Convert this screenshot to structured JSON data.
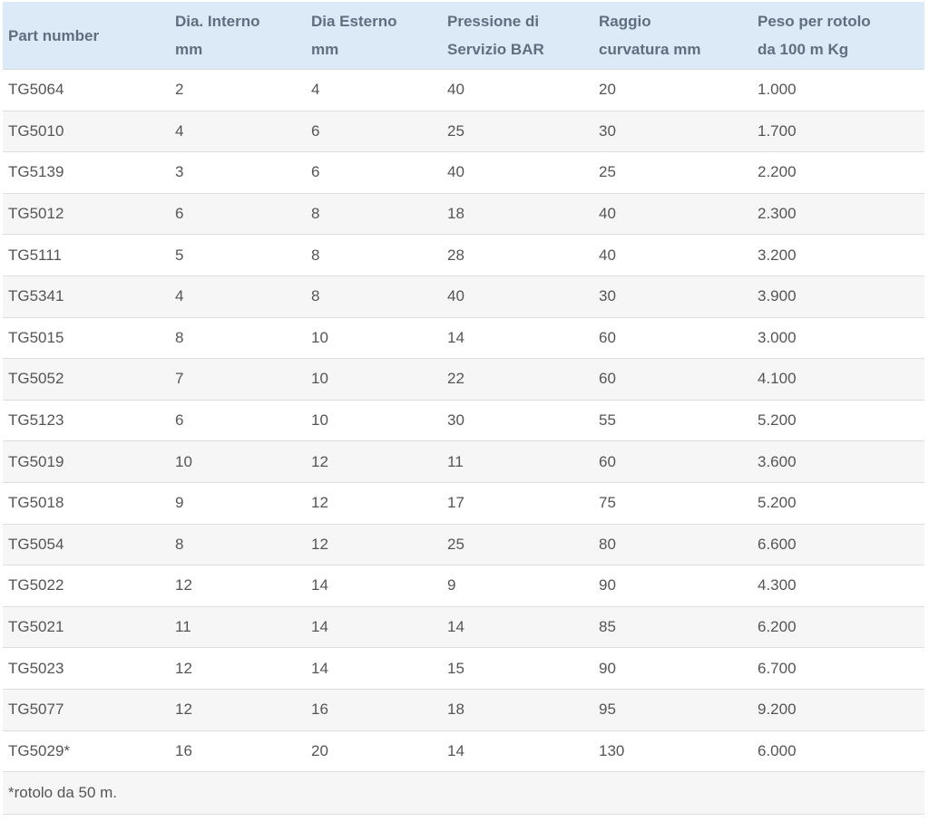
{
  "table": {
    "headers": [
      "Part number",
      "Dia. Interno\nmm",
      "Dia Esterno\nmm",
      "Pressione di\nServizio BAR",
      "Raggio\ncurvatura mm",
      "Peso per rotolo\nda 100 m Kg"
    ],
    "rows": [
      [
        "TG5064",
        "2",
        "4",
        "40",
        "20",
        "1.000"
      ],
      [
        "TG5010",
        "4",
        "6",
        "25",
        "30",
        "1.700"
      ],
      [
        "TG5139",
        "3",
        "6",
        "40",
        "25",
        "2.200"
      ],
      [
        "TG5012",
        "6",
        "8",
        "18",
        "40",
        "2.300"
      ],
      [
        "TG5111",
        "5",
        "8",
        "28",
        "40",
        "3.200"
      ],
      [
        "TG5341",
        "4",
        "8",
        "40",
        "30",
        "3.900"
      ],
      [
        "TG5015",
        "8",
        "10",
        "14",
        "60",
        "3.000"
      ],
      [
        "TG5052",
        "7",
        "10",
        "22",
        "60",
        "4.100"
      ],
      [
        "TG5123",
        "6",
        "10",
        "30",
        "55",
        "5.200"
      ],
      [
        "TG5019",
        "10",
        "12",
        "11",
        "60",
        "3.600"
      ],
      [
        "TG5018",
        "9",
        "12",
        "17",
        "75",
        "5.200"
      ],
      [
        "TG5054",
        "8",
        "12",
        "25",
        "80",
        "6.600"
      ],
      [
        "TG5022",
        "12",
        "14",
        "9",
        "90",
        "4.300"
      ],
      [
        "TG5021",
        "11",
        "14",
        "14",
        "85",
        "6.200"
      ],
      [
        "TG5023",
        "12",
        "14",
        "15",
        "90",
        "6.700"
      ],
      [
        "TG5077",
        "12",
        "16",
        "18",
        "95",
        "9.200"
      ],
      [
        "TG5029*",
        "16",
        "20",
        "14",
        "130",
        "6.000"
      ]
    ],
    "footnote": "*rotolo da 50 m."
  }
}
